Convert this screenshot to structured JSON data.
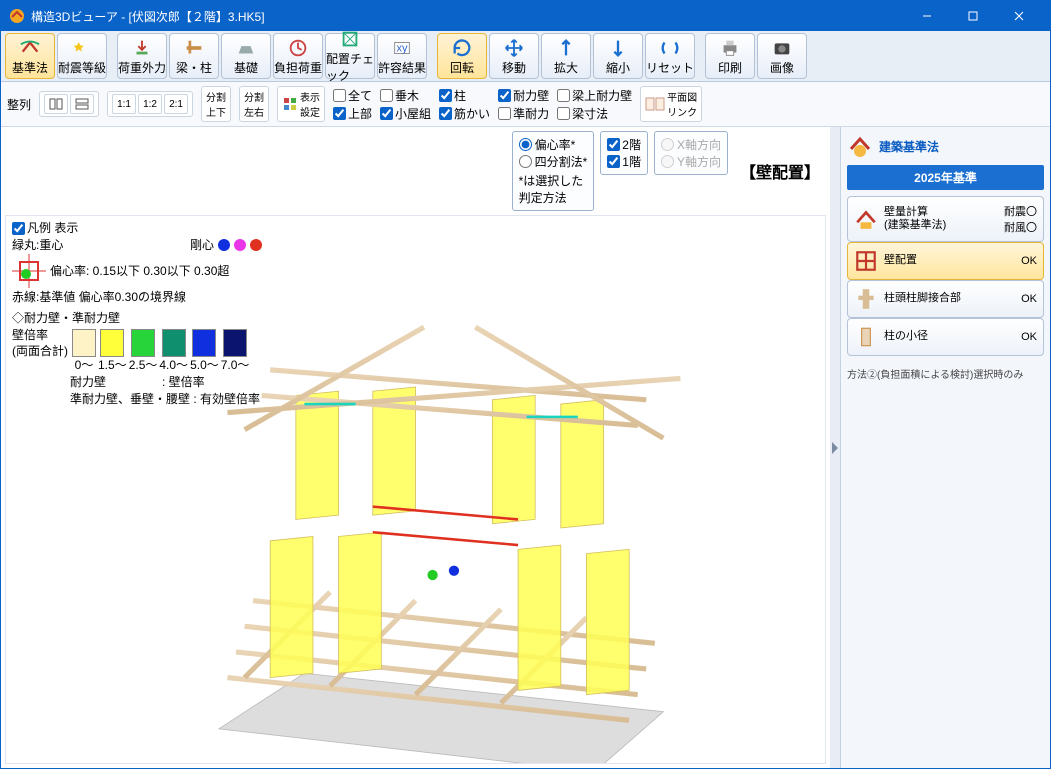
{
  "window": {
    "title": "構造3Dビューア - [伏図次郎【２階】3.HK5]"
  },
  "toolbar": [
    {
      "id": "kijunho",
      "label": "基準法",
      "active": true
    },
    {
      "id": "taishin",
      "label": "耐震等級"
    },
    {
      "id": "kaju",
      "label": "荷重外力"
    },
    {
      "id": "hari",
      "label": "梁・柱"
    },
    {
      "id": "kiso",
      "label": "基礎"
    },
    {
      "id": "futan",
      "label": "負担荷重"
    },
    {
      "id": "haichi",
      "label": "配置チェック"
    },
    {
      "id": "kyoyo",
      "label": "許容結果"
    },
    {
      "id": "kaiten",
      "label": "回転",
      "active": true
    },
    {
      "id": "ido",
      "label": "移動"
    },
    {
      "id": "kakudai",
      "label": "拡大"
    },
    {
      "id": "shukusho",
      "label": "縮小"
    },
    {
      "id": "reset",
      "label": "リセット"
    },
    {
      "id": "insatsu",
      "label": "印刷"
    },
    {
      "id": "gazo",
      "label": "画像"
    }
  ],
  "optbar": {
    "seiretsu": "整列",
    "ratios": [
      "1:1",
      "1:2",
      "2:1"
    ],
    "bunkatsu1": "分割\n上下",
    "bunkatsu2": "分割\n左右",
    "hyoji": "表示\n設定",
    "checks": {
      "subete": "全て",
      "taruki": "垂木",
      "hashira": "柱",
      "tairyoku": "耐力壁",
      "haribeam": "梁上耐力壁",
      "jobu": "上部",
      "koyagumi": "小屋組",
      "sujikai": "筋かい",
      "juntairyoku": "準耐力",
      "harisun": "梁寸法"
    },
    "heimen": "平面図\nリンク"
  },
  "controls": {
    "method": {
      "hensin": "偏心率*",
      "shibun": "四分割法*",
      "note": "*は選択した\n判定方法"
    },
    "floors": {
      "f2": "2階",
      "f1": "1階"
    },
    "axes": {
      "x": "X軸方向",
      "y": "Y軸方向"
    },
    "viewtitle": "【壁配置】"
  },
  "legend": {
    "show": "凡例 表示",
    "l1a": "緑丸:重心",
    "l1b": "剛心",
    "l2": "偏心率: 0.15以下 0.30以下 0.30超",
    "l3": "赤線:基準値 偏心率0.30の境界線",
    "sec": "◇耐力壁・準耐力壁",
    "kabe": "壁倍率\n(両面合計)",
    "ranges": [
      "0～",
      "1.5～",
      "2.5～",
      "4.0～",
      "5.0～",
      "7.0～"
    ],
    "colors": [
      "#fdf3c6",
      "#ffff3a",
      "#27d43a",
      "#0f8f6e",
      "#1030e0",
      "#0b1570"
    ],
    "note1": "耐力壁",
    "note1b": ": 壁倍率",
    "note2": "準耐力壁、垂壁・腰壁 : 有効壁倍率"
  },
  "right": {
    "title": "建築基準法",
    "year": "2025年基準",
    "items": [
      {
        "id": "kaberyo",
        "t": "壁量計算\n(建築基準法)",
        "st": "耐震〇\n耐風〇"
      },
      {
        "id": "kabehaichi",
        "t": "壁配置",
        "st": "OK",
        "sel": true
      },
      {
        "id": "chutou",
        "t": "柱頭柱脚接合部",
        "st": "OK"
      },
      {
        "id": "shokei",
        "t": "柱の小径",
        "st": "OK"
      }
    ],
    "note": "方法②(負担面積による検討)選択時のみ"
  }
}
